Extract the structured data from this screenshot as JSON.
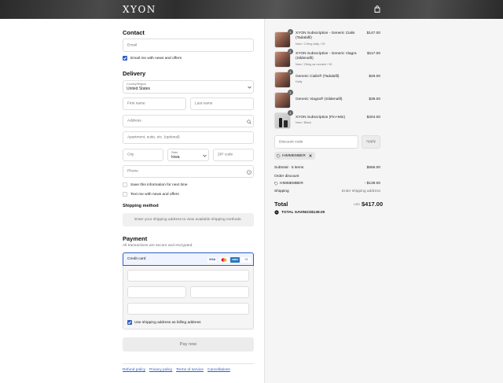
{
  "header": {
    "brand": "XYON",
    "cart_icon": "shopping-bag-icon"
  },
  "contact": {
    "heading": "Contact",
    "email_placeholder": "Email",
    "email_news_label": "Email me with news and offers",
    "email_news_checked": true
  },
  "delivery": {
    "heading": "Delivery",
    "country_label": "Country/Region",
    "country_value": "United States",
    "first_name_placeholder": "First name",
    "last_name_placeholder": "Last name",
    "address_placeholder": "Address",
    "apartment_placeholder": "Apartment, suite, etc. (optional)",
    "city_placeholder": "City",
    "state_label": "State",
    "state_value": "Iowa",
    "zip_placeholder": "ZIP code",
    "phone_placeholder": "Phone",
    "save_info_label": "Save this information for next time",
    "text_news_label": "Text me with news and offers"
  },
  "shipping": {
    "heading": "Shipping method",
    "notice": "Enter your shipping address to view available shipping methods."
  },
  "payment": {
    "heading": "Payment",
    "subtitle": "All transactions are secure and encrypted.",
    "method_label": "Credit card",
    "card_brands": [
      "VISA",
      "Mastercard",
      "AMEX",
      "+3"
    ],
    "billing_label": "Use shipping address as billing address",
    "pay_button": "Pay now"
  },
  "footer_links": [
    "Refund policy",
    "Privacy policy",
    "Terms of service",
    "Cancellations"
  ],
  "order": {
    "items": [
      {
        "qty": "1",
        "name": "XYON Subscription - Generic Cialis (Tadalafil)",
        "sub": "New / 2.5mg daily / 90",
        "price": "$147.00"
      },
      {
        "qty": "1",
        "name": "XYON Subscription - Generic Viagra (Sildenafil)",
        "sub": "New / 25mg as needed / 90",
        "price": "$117.00"
      },
      {
        "qty": "1",
        "name": "Generic Cialis® (Tadalafil)",
        "sub": "Daily",
        "price": "$49.00"
      },
      {
        "qty": "1",
        "name": "Generic Viagra® (Sildenafil)",
        "sub": "",
        "price": "$39.00"
      },
      {
        "qty": "1",
        "name": "XYON Subscription (Fin+Min)",
        "sub": "New / Black",
        "price": "$204.00"
      }
    ],
    "discount_placeholder": "Discount code",
    "apply_label": "Apply",
    "applied_code": "HIMMEMBER",
    "subtotal_label": "Subtotal · 5 items",
    "subtotal_value": "$556.00",
    "order_discount_label": "Order discount",
    "discount_code_label": "HIMMEMBER",
    "discount_value": "- $139.00",
    "shipping_label": "Shipping",
    "shipping_value": "Enter shipping address",
    "total_label": "Total",
    "currency": "USD",
    "total_value": "$417.00",
    "savings_label": "TOTAL SAVINGS",
    "savings_value": "$139.00"
  }
}
